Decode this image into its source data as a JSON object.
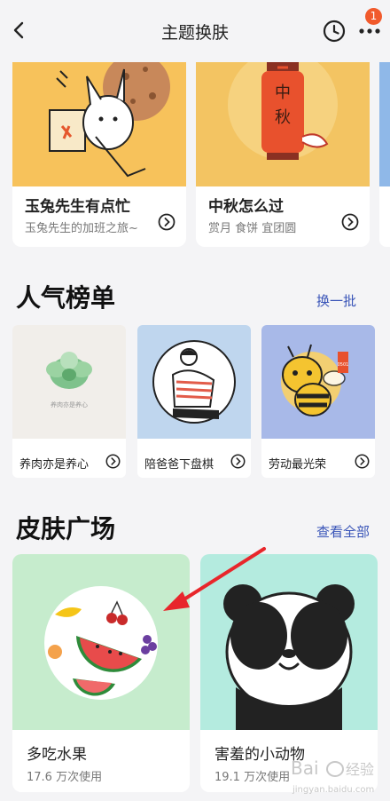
{
  "header": {
    "title": "主题换肤",
    "badge_count": "1"
  },
  "top_cards": [
    {
      "name": "玉兔先生有点忙",
      "sub": "玉兔先生的加班之旅~"
    },
    {
      "name": "中秋怎么过",
      "sub": "赏月 食饼 宜团圆",
      "art_text_1": "中",
      "art_text_2": "秋"
    }
  ],
  "popular": {
    "title": "人气榜单",
    "action": "换一批",
    "items": [
      {
        "name": "养肉亦是养心",
        "art_caption": "养肉亦是养心"
      },
      {
        "name": "陪爸爸下盘棋"
      },
      {
        "name": "劳动最光荣",
        "art_tag": "0501"
      }
    ]
  },
  "plaza": {
    "title": "皮肤广场",
    "action": "查看全部",
    "items": [
      {
        "name": "多吃水果",
        "usage": "17.6 万次使用"
      },
      {
        "name": "害羞的小动物",
        "usage": "19.1 万次使用"
      }
    ]
  },
  "watermark": {
    "line1": "Bai",
    "line2": "经验",
    "line3": "jingyan.baidu.com"
  },
  "colors": {
    "link": "#3a55b8",
    "badge": "#f15a2c",
    "arrow": "#e8262b"
  }
}
